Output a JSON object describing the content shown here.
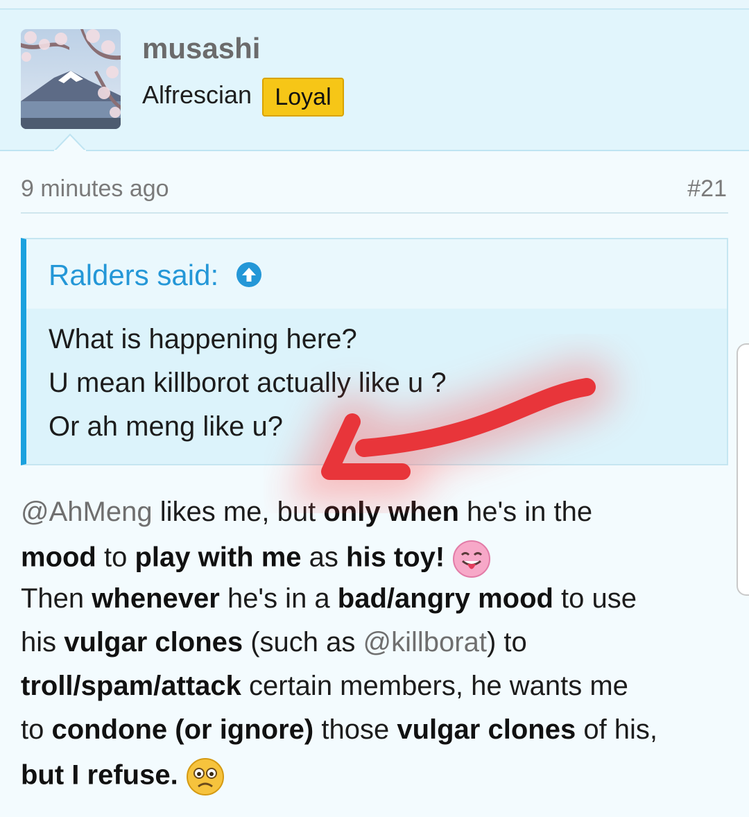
{
  "user": {
    "name": "musashi",
    "title": "Alfrescian",
    "badge": "Loyal"
  },
  "post_meta": {
    "time": "9 minutes ago",
    "number": "#21"
  },
  "quote": {
    "author": "Ralders said:",
    "lines": [
      "What is happening here?",
      "U mean killborot actually like u ?",
      "Or ah meng like u?"
    ]
  },
  "post": {
    "l1": {
      "mention": "@AhMeng",
      "a": " likes me, but ",
      "b1": "only when",
      "c": " he's in the"
    },
    "l2": {
      "b1": "mood",
      "a": " to ",
      "b2": "play with me",
      "c": " as ",
      "b3": "his toy!"
    },
    "l3": {
      "a": "Then ",
      "b1": "whenever",
      "c": " he's in a ",
      "b2": "bad/angry mood",
      "d": " to use"
    },
    "l4": {
      "a": "his ",
      "b1": "vulgar clones",
      "c": " (such as ",
      "mention": "@killborat",
      "d": ") to"
    },
    "l5": {
      "b1": "troll/spam/attack",
      "a": " certain members, he wants me"
    },
    "l6": {
      "a": "to ",
      "b1": "condone (or ignore)",
      "c": " those ",
      "b2": "vulgar clones",
      "d": " of his,"
    },
    "l7": {
      "b1": "but I refuse."
    }
  },
  "icons": {
    "quote_jump": "arrow-up-circle-icon",
    "emoji_tongue": "tongue-out-emoji",
    "emoji_worried": "worried-emoji"
  },
  "colors": {
    "accent": "#1ba1de",
    "badge": "#f6c617",
    "annotation": "#e8353a"
  }
}
